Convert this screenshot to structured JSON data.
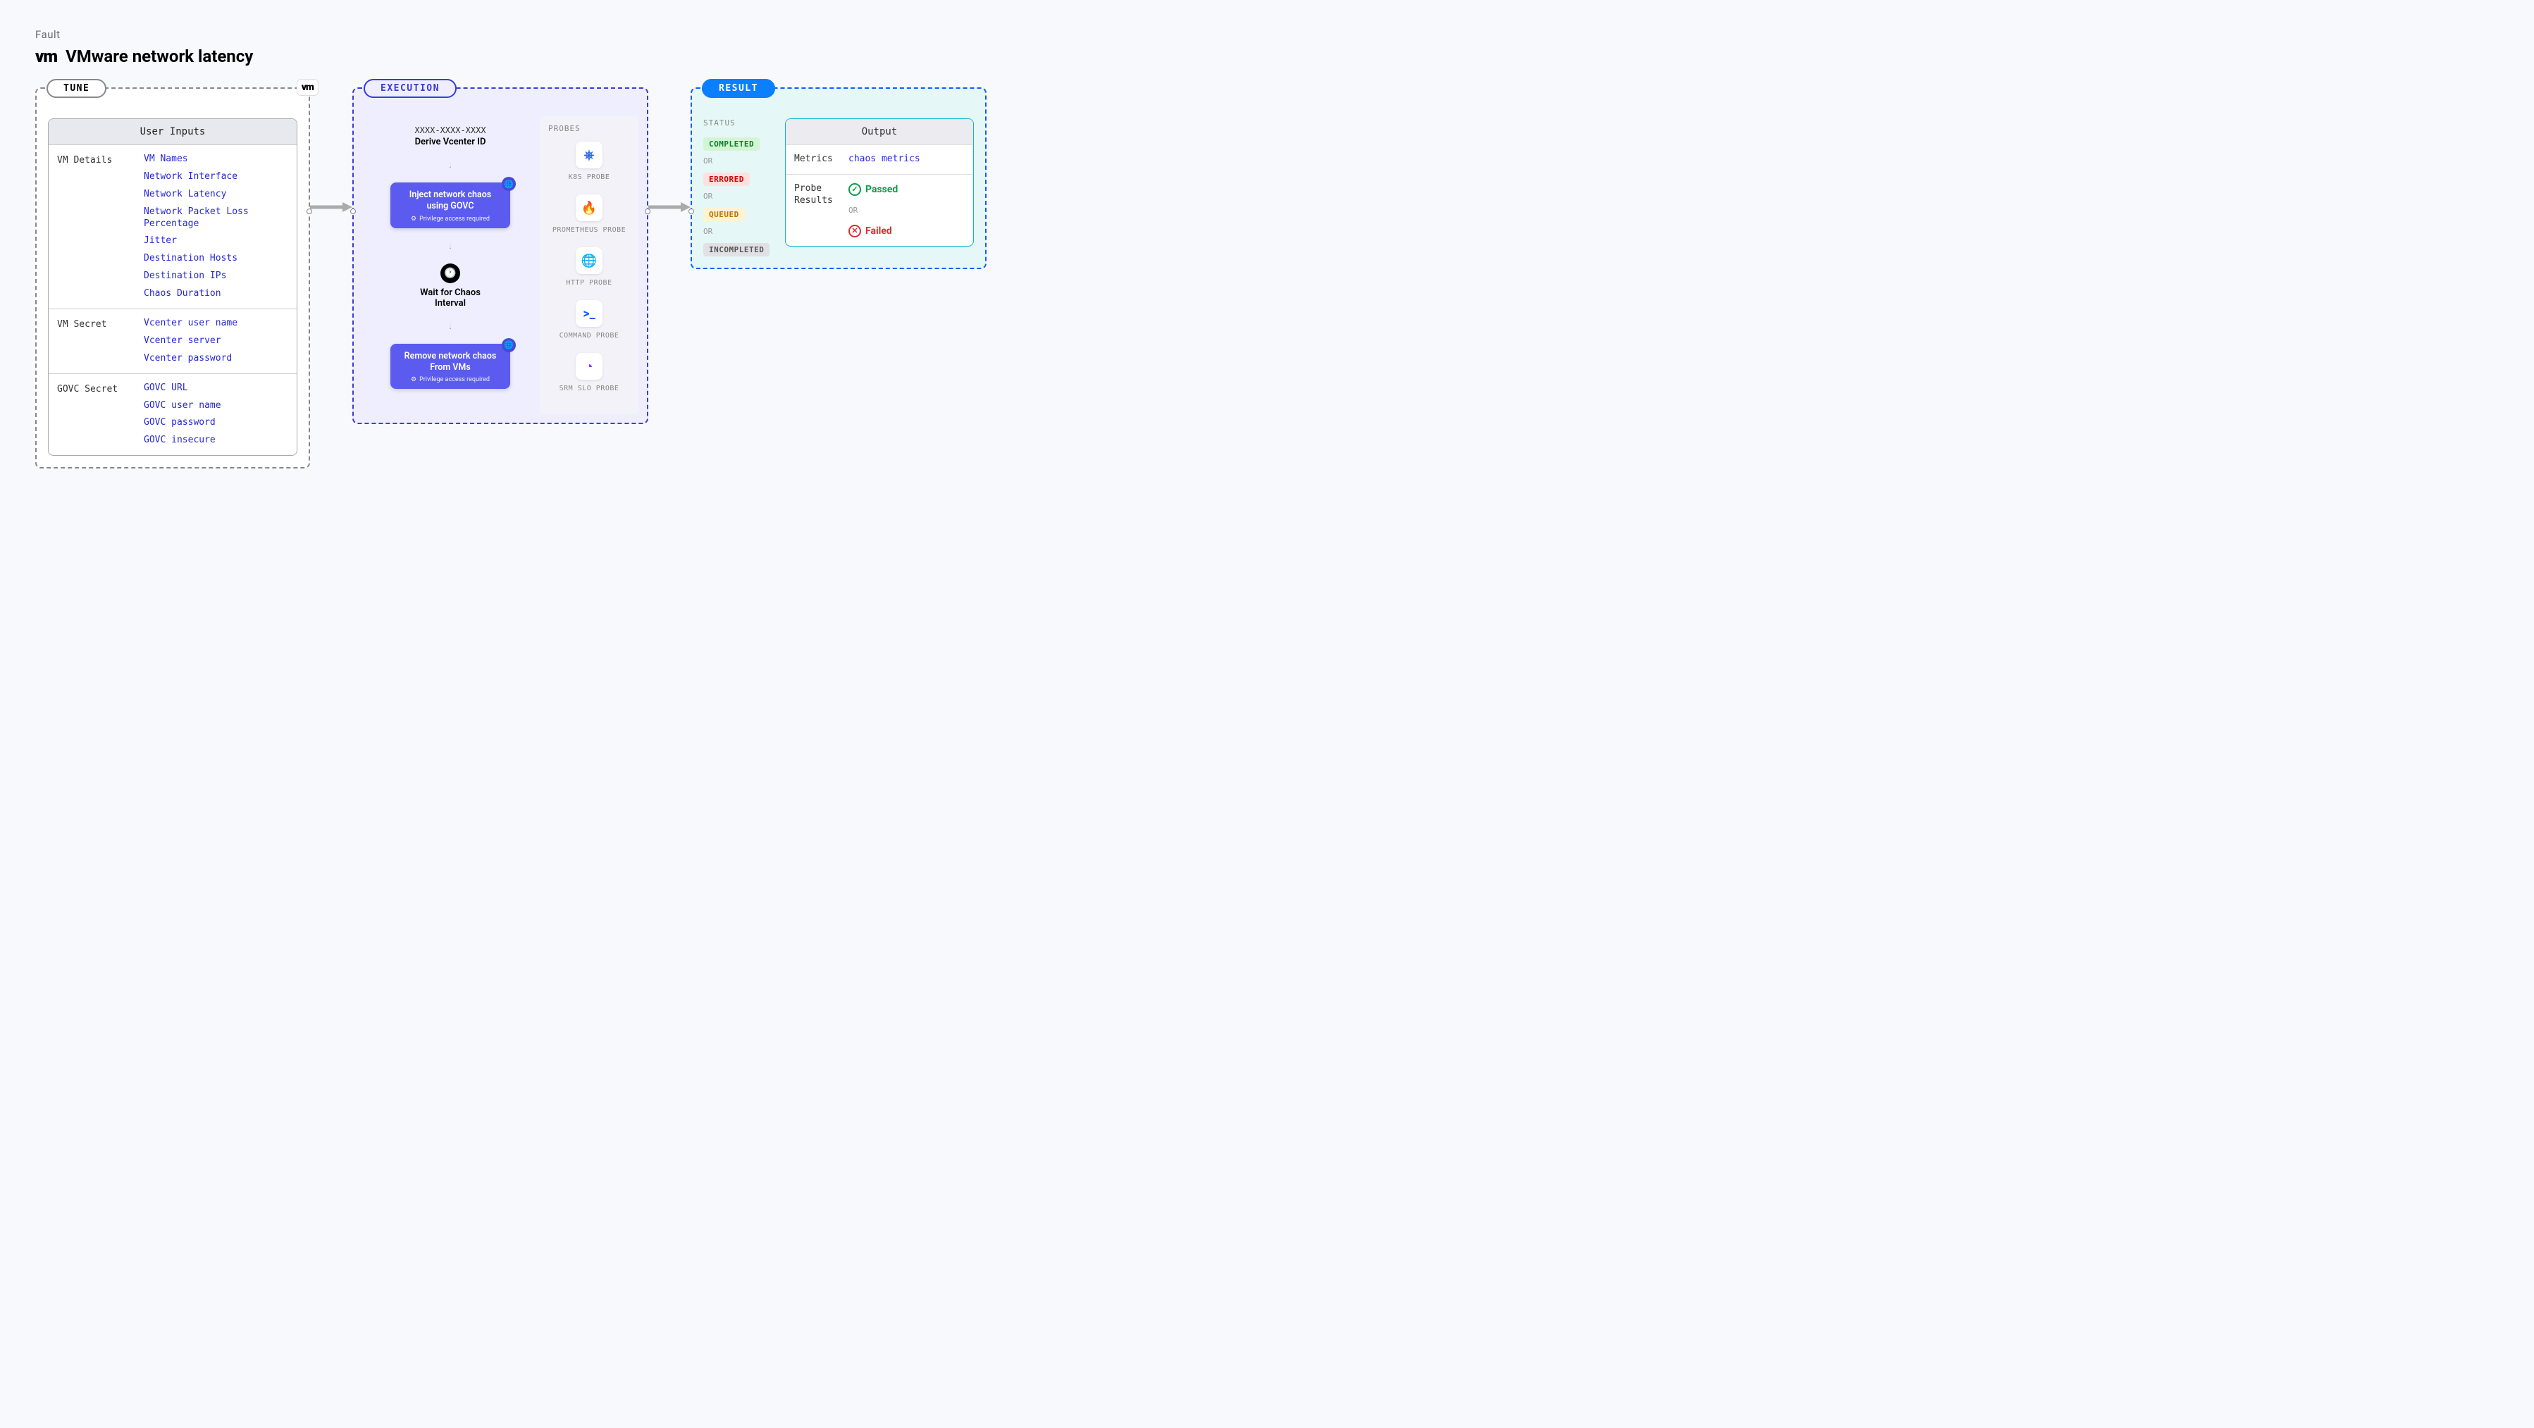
{
  "header": {
    "fault": "Fault",
    "logo": "vm",
    "title": "VMware network latency"
  },
  "tune": {
    "label": "TUNE",
    "badge": "vm",
    "inputs_header": "User Inputs",
    "groups": [
      {
        "label": "VM Details",
        "items": [
          "VM Names",
          "Network Interface",
          "Network Latency",
          "Network Packet Loss Percentage",
          "Jitter",
          "Destination Hosts",
          "Destination IPs",
          "Chaos Duration"
        ]
      },
      {
        "label": "VM Secret",
        "items": [
          "Vcenter user name",
          "Vcenter server",
          "Vcenter password"
        ]
      },
      {
        "label": "GOVC Secret",
        "items": [
          "GOVC URL",
          "GOVC user name",
          "GOVC password",
          "GOVC insecure"
        ]
      }
    ]
  },
  "execution": {
    "label": "EXECUTION",
    "derive_id": "XXXX-XXXX-XXXX",
    "derive_text": "Derive Vcenter ID",
    "inject": {
      "title": "Inject network chaos using GOVC",
      "sub": "Privilege access required"
    },
    "wait": "Wait for Chaos Interval",
    "remove": {
      "title": "Remove network chaos From VMs",
      "sub": "Privilege access required"
    },
    "probes_header": "PROBES",
    "probes": [
      {
        "name": "k8s-probe",
        "label": "K8S PROBE",
        "color": "#326ce5",
        "glyph": "⎈"
      },
      {
        "name": "prometheus-probe",
        "label": "PROMETHEUS PROBE",
        "color": "#e6522c",
        "glyph": "🔥"
      },
      {
        "name": "http-probe",
        "label": "HTTP PROBE",
        "color": "#1a5fff",
        "glyph": "🌐"
      },
      {
        "name": "command-probe",
        "label": "COMMAND PROBE",
        "color": "#1a5fff",
        "glyph": ">_"
      },
      {
        "name": "srm-slo-probe",
        "label": "SRM SLO PROBE",
        "color": "#8b3ff0",
        "glyph": "◔"
      }
    ]
  },
  "result": {
    "label": "RESULT",
    "status_header": "STATUS",
    "or": "OR",
    "statuses": [
      {
        "text": "COMPLETED",
        "class": "bg-green"
      },
      {
        "text": "ERRORED",
        "class": "bg-red"
      },
      {
        "text": "QUEUED",
        "class": "bg-yellow"
      },
      {
        "text": "INCOMPLETED",
        "class": "bg-gray"
      }
    ],
    "output_header": "Output",
    "metrics_label": "Metrics",
    "metrics_value": "chaos metrics",
    "probe_results_label": "Probe Results",
    "passed": "Passed",
    "failed": "Failed"
  }
}
